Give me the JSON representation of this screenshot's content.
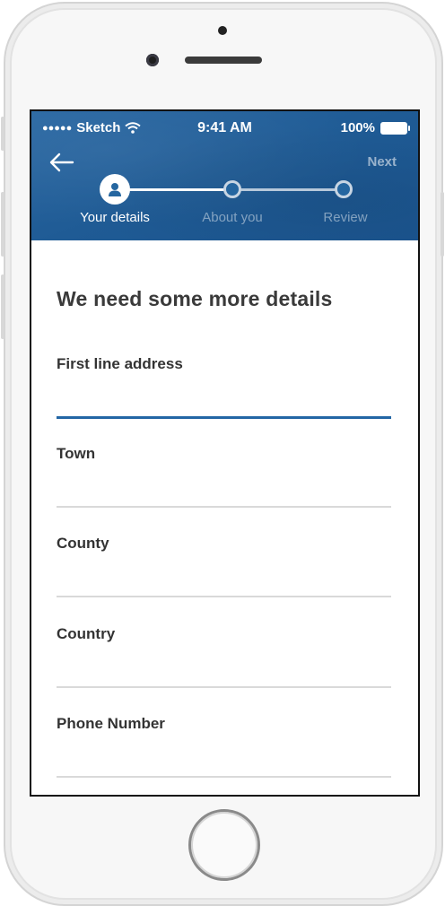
{
  "status_bar": {
    "carrier": "Sketch",
    "time": "9:41 AM",
    "battery": "100%"
  },
  "header": {
    "back_icon": "arrow-left-icon",
    "next_label": "Next",
    "steps": [
      {
        "label": "Your details",
        "state": "active",
        "icon": "user-icon"
      },
      {
        "label": "About you",
        "state": "inactive"
      },
      {
        "label": "Review",
        "state": "inactive"
      }
    ],
    "colors": {
      "accent": "#1f5b95",
      "focus_line": "#2366a5"
    }
  },
  "form": {
    "heading": "We need some more details",
    "fields": [
      {
        "label": "First line address",
        "value": "",
        "focused": true
      },
      {
        "label": "Town",
        "value": "",
        "focused": false
      },
      {
        "label": "County",
        "value": "",
        "focused": false
      },
      {
        "label": "Country",
        "value": "",
        "focused": false
      },
      {
        "label": "Phone Number",
        "value": "",
        "focused": false
      }
    ]
  }
}
